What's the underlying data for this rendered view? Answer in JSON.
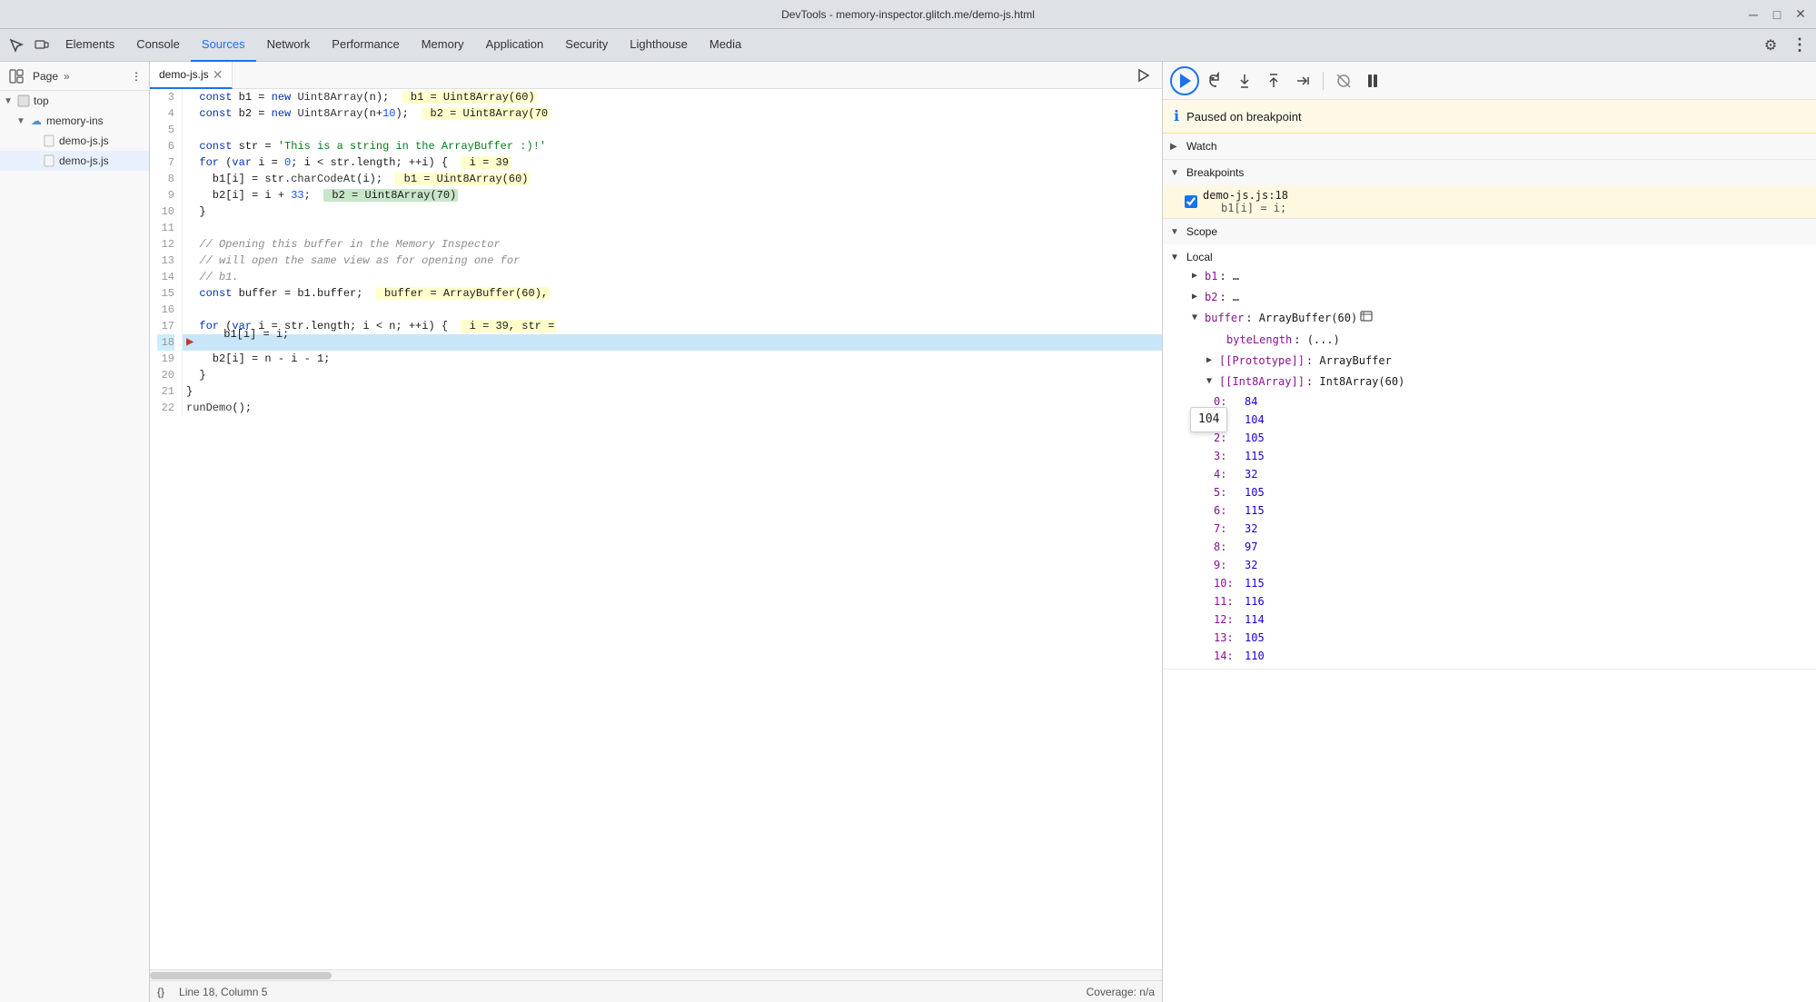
{
  "titleBar": {
    "title": "DevTools - memory-inspector.glitch.me/demo-js.html",
    "controls": [
      "minimize",
      "maximize",
      "close"
    ]
  },
  "topTabs": {
    "items": [
      {
        "label": "Elements",
        "active": false
      },
      {
        "label": "Console",
        "active": false
      },
      {
        "label": "Sources",
        "active": true
      },
      {
        "label": "Network",
        "active": false
      },
      {
        "label": "Performance",
        "active": false
      },
      {
        "label": "Memory",
        "active": false
      },
      {
        "label": "Application",
        "active": false
      },
      {
        "label": "Security",
        "active": false
      },
      {
        "label": "Lighthouse",
        "active": false
      },
      {
        "label": "Media",
        "active": false
      }
    ]
  },
  "filePanel": {
    "tabs": [
      "Page",
      ">>"
    ],
    "tree": [
      {
        "label": "top",
        "type": "page",
        "indent": 0,
        "expanded": true
      },
      {
        "label": "memory-ins",
        "type": "cloud",
        "indent": 1,
        "expanded": true
      },
      {
        "label": "demo-js.js",
        "type": "js",
        "indent": 2
      },
      {
        "label": "demo-js.js",
        "type": "js",
        "indent": 2
      }
    ]
  },
  "codeTabs": [
    {
      "label": "demo-js.js",
      "active": true
    }
  ],
  "codeLines": [
    {
      "num": 3,
      "content": "  const b1 = new Uint8Array(n);",
      "hint": "b1 = Uint8Array(60)"
    },
    {
      "num": 4,
      "content": "  const b2 = new Uint8Array(n+10);",
      "hint": "b2 = Uint8Array(70"
    },
    {
      "num": 5,
      "content": ""
    },
    {
      "num": 6,
      "content": "  const str = 'This is a string in the ArrayBuffer :)!'"
    },
    {
      "num": 7,
      "content": "  for (var i = 0; i < str.length; ++i) {",
      "hint": "i = 39"
    },
    {
      "num": 8,
      "content": "    b1[i] = str.charCodeAt(i);",
      "hint": "b1 = Uint8Array(60)"
    },
    {
      "num": 9,
      "content": "    b2[i] = i + 33;",
      "hint": "b2 = Uint8Array(70)"
    },
    {
      "num": 10,
      "content": "  }"
    },
    {
      "num": 11,
      "content": ""
    },
    {
      "num": 12,
      "content": "  // Opening this buffer in the Memory Inspector"
    },
    {
      "num": 13,
      "content": "  // will open the same view as for opening one for"
    },
    {
      "num": 14,
      "content": "  // b1."
    },
    {
      "num": 15,
      "content": "  const buffer = b1.buffer;",
      "hint": "buffer = ArrayBuffer(60),"
    },
    {
      "num": 16,
      "content": ""
    },
    {
      "num": 17,
      "content": "  for (var i = str.length; i < n; ++i) {",
      "hint": "i = 39, str ="
    },
    {
      "num": 18,
      "content": "    b1[i] = i;",
      "active": true
    },
    {
      "num": 19,
      "content": "    b2[i] = n - i - 1;"
    },
    {
      "num": 20,
      "content": "  }"
    },
    {
      "num": 21,
      "content": "}"
    },
    {
      "num": 22,
      "content": "runDemo();"
    }
  ],
  "statusBar": {
    "braces": "{}",
    "position": "Line 18, Column 5",
    "coverage": "Coverage: n/a"
  },
  "debugToolbar": {
    "buttons": [
      {
        "name": "resume",
        "icon": "▶",
        "type": "circle-border"
      },
      {
        "name": "step-over",
        "icon": "↷"
      },
      {
        "name": "step-into",
        "icon": "↓"
      },
      {
        "name": "step-out",
        "icon": "↑"
      },
      {
        "name": "step",
        "icon": "→"
      },
      {
        "name": "deactivate",
        "icon": "✏"
      },
      {
        "name": "pause-exceptions",
        "icon": "⏸"
      }
    ]
  },
  "pausedBanner": {
    "text": "Paused on breakpoint"
  },
  "watchSection": {
    "title": "Watch",
    "collapsed": true
  },
  "breakpointsSection": {
    "title": "Breakpoints",
    "items": [
      {
        "file": "demo-js.js:18",
        "code": "b1[i] = i;"
      }
    ]
  },
  "scopeSection": {
    "title": "Scope",
    "localSection": {
      "label": "Local",
      "items": [
        {
          "name": "b1",
          "value": "…",
          "expandable": true
        },
        {
          "name": "b2",
          "value": "…",
          "expandable": true
        },
        {
          "name": "buffer",
          "value": "ArrayBuffer(60)",
          "expandable": true,
          "hasMemInspector": true
        },
        {
          "name": "byteLength",
          "value": "(...)"
        },
        {
          "name": "[[Prototype]]",
          "value": "ArrayBuffer",
          "expandable": true
        },
        {
          "name": "[[Int8Array]]",
          "value": "Int8Array(60)",
          "expandable": true,
          "expanded": true
        }
      ],
      "arrayItems": [
        {
          "key": "0:",
          "val": "84"
        },
        {
          "key": "1:",
          "val": "104"
        },
        {
          "key": "2:",
          "val": "105"
        },
        {
          "key": "3:",
          "val": "115"
        },
        {
          "key": "4:",
          "val": "32"
        },
        {
          "key": "5:",
          "val": "105"
        },
        {
          "key": "6:",
          "val": "115"
        },
        {
          "key": "7:",
          "val": "32"
        },
        {
          "key": "8:",
          "val": "97"
        },
        {
          "key": "9:",
          "val": "32"
        },
        {
          "key": "10:",
          "val": "115"
        },
        {
          "key": "11:",
          "val": "116"
        },
        {
          "key": "12:",
          "val": "114"
        },
        {
          "key": "13:",
          "val": "105"
        },
        {
          "key": "14:",
          "val": "110"
        }
      ]
    }
  },
  "tooltip": {
    "value": "104"
  }
}
